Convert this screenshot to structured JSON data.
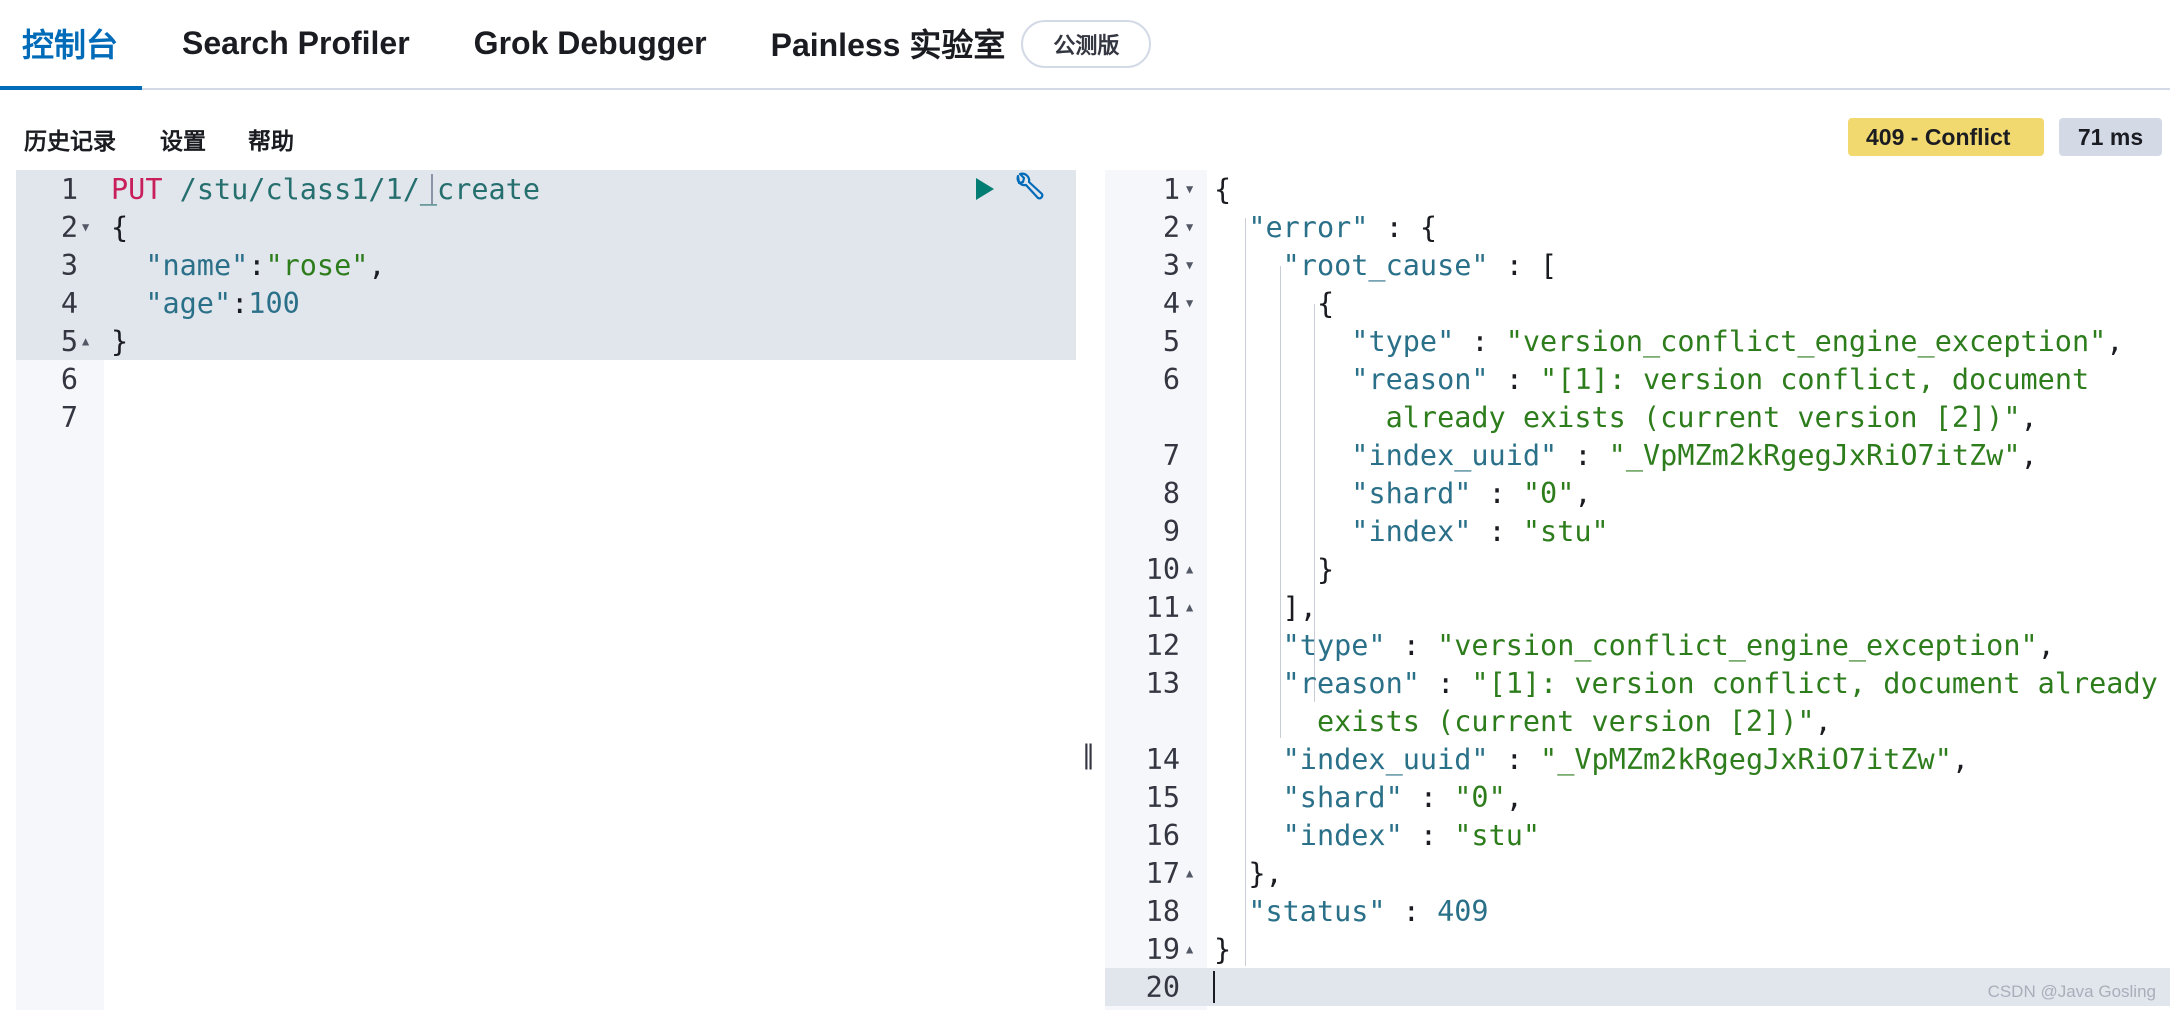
{
  "tabs": [
    {
      "label": "控制台",
      "active": true
    },
    {
      "label": "Search Profiler",
      "active": false
    },
    {
      "label": "Grok Debugger",
      "active": false
    },
    {
      "label": "Painless 实验室",
      "active": false
    }
  ],
  "beta_badge": "公测版",
  "toolbar": {
    "history": "历史记录",
    "settings": "设置",
    "help": "帮助"
  },
  "response_status": {
    "status": "409 - Conflict",
    "time": "71 ms",
    "status_color": "#f1d86f"
  },
  "request_editor": {
    "lines": [
      {
        "n": "1",
        "text": "PUT /stu/class1/1/_create"
      },
      {
        "n": "2",
        "text": "{"
      },
      {
        "n": "3",
        "text": "  \"name\":\"rose\","
      },
      {
        "n": "4",
        "text": "  \"age\":100"
      },
      {
        "n": "5",
        "text": "}"
      },
      {
        "n": "6",
        "text": ""
      },
      {
        "n": "7",
        "text": ""
      }
    ],
    "method": "PUT",
    "path": "/stu/class1/1/_create"
  },
  "response_editor": {
    "line_numbers": [
      "1",
      "2",
      "3",
      "4",
      "5",
      "6",
      "7",
      "8",
      "9",
      "10",
      "11",
      "12",
      "13",
      "14",
      "15",
      "16",
      "17",
      "18",
      "19",
      "20"
    ],
    "error_type": "version_conflict_engine_exception",
    "reason_a": "[1]: version conflict, document",
    "reason_b": "already exists (current version [2])",
    "reason_c": "[1]: version conflict, document already",
    "reason_d": "exists (current version [2])",
    "index_uuid": "_VpMZm2kRgegJxRiO7itZw",
    "shard": "0",
    "index": "stu",
    "status": "409"
  },
  "watermark": "CSDN @Java Gosling"
}
